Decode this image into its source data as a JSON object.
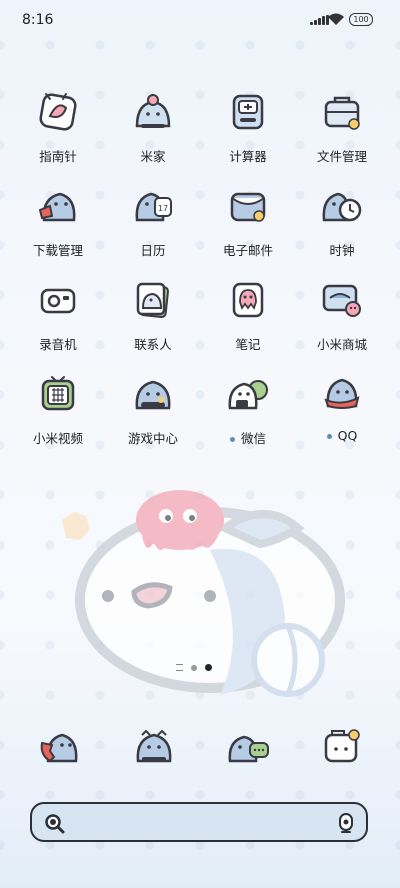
{
  "status_bar": {
    "time": "8:16",
    "battery": "100",
    "icons": [
      "signal-icon",
      "wifi-icon",
      "battery-icon"
    ]
  },
  "apps": [
    {
      "label": "指南针",
      "icon": "compass-icon"
    },
    {
      "label": "米家",
      "icon": "mijia-icon"
    },
    {
      "label": "计算器",
      "icon": "calculator-icon"
    },
    {
      "label": "文件管理",
      "icon": "file-manager-icon"
    },
    {
      "label": "下载管理",
      "icon": "download-manager-icon"
    },
    {
      "label": "日历",
      "icon": "calendar-icon"
    },
    {
      "label": "电子邮件",
      "icon": "email-icon"
    },
    {
      "label": "时钟",
      "icon": "clock-icon"
    },
    {
      "label": "录音机",
      "icon": "recorder-icon"
    },
    {
      "label": "联系人",
      "icon": "contacts-icon"
    },
    {
      "label": "笔记",
      "icon": "notes-icon"
    },
    {
      "label": "小米商城",
      "icon": "mi-store-icon"
    },
    {
      "label": "小米视频",
      "icon": "mi-video-icon"
    },
    {
      "label": "游戏中心",
      "icon": "game-center-icon"
    },
    {
      "label": "微信",
      "icon": "wechat-icon",
      "new": true
    },
    {
      "label": "QQ",
      "icon": "qq-icon",
      "new": true
    }
  ],
  "pager": {
    "pages": 2,
    "current": 2
  },
  "dock": [
    "phone-icon",
    "browser-icon",
    "messages-icon",
    "camera-icon"
  ],
  "search_bar": {
    "icons": [
      "search-icon",
      "microphone-icon"
    ]
  },
  "colors": {
    "accent_blue": "#5b8fb9",
    "pink": "#f4a7b4",
    "outline": "#3a3a44"
  }
}
